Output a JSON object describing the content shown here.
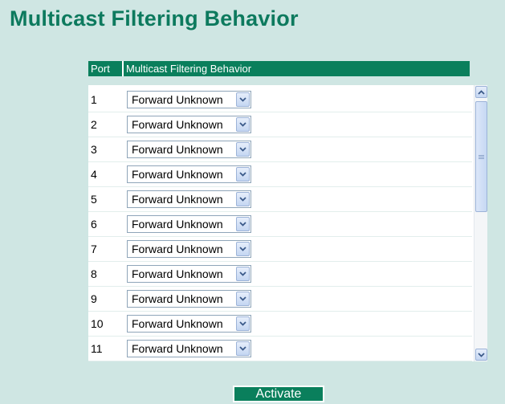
{
  "page": {
    "title": "Multicast Filtering Behavior"
  },
  "table": {
    "columns": [
      "Port",
      "Multicast Filtering Behavior"
    ],
    "rows": [
      {
        "port": "1",
        "behavior": "Forward Unknown"
      },
      {
        "port": "2",
        "behavior": "Forward Unknown"
      },
      {
        "port": "3",
        "behavior": "Forward Unknown"
      },
      {
        "port": "4",
        "behavior": "Forward Unknown"
      },
      {
        "port": "5",
        "behavior": "Forward Unknown"
      },
      {
        "port": "6",
        "behavior": "Forward Unknown"
      },
      {
        "port": "7",
        "behavior": "Forward Unknown"
      },
      {
        "port": "8",
        "behavior": "Forward Unknown"
      },
      {
        "port": "9",
        "behavior": "Forward Unknown"
      },
      {
        "port": "10",
        "behavior": "Forward Unknown"
      },
      {
        "port": "11",
        "behavior": "Forward Unknown"
      }
    ]
  },
  "icons": {
    "dropdown": "chevron-down-icon",
    "scroll_up": "scroll-up-arrow-icon",
    "scroll_down": "scroll-down-arrow-icon"
  },
  "colors": {
    "accent": "#0a7f5c",
    "title": "#0d7a5e",
    "background": "#cfe6e3"
  },
  "actions": {
    "activate_label": "Activate"
  }
}
